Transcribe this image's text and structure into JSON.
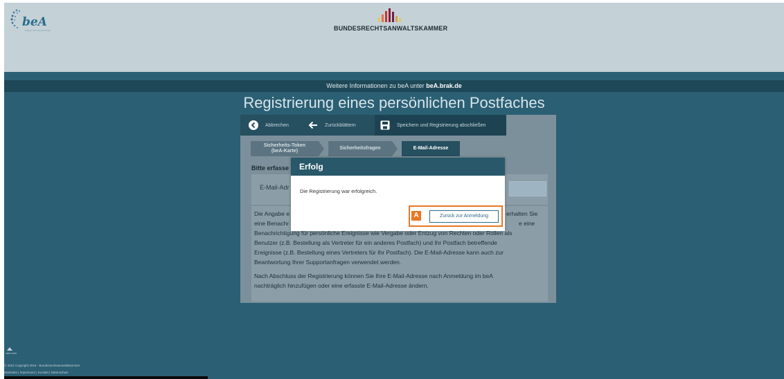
{
  "header": {
    "logo_text": "beA",
    "logo_tagline": "Digitale Schnittstelle Anwalt",
    "brak_name": "BUNDESRECHTSANWALTSKAMMER",
    "brand_colors": [
      "#e9c46a",
      "#e76f51",
      "#c0392b",
      "#8e1b3a",
      "#6b1f4a",
      "#d1a84b"
    ]
  },
  "infobar": {
    "prefix": "Weitere Informationen zu beA unter",
    "link": "beA.brak.de"
  },
  "page_title": "Registrierung eines persönlichen Postfaches",
  "toolbar": {
    "cancel": {
      "icon": "arrow-left-circle-icon",
      "label": "Abbrechen"
    },
    "back": {
      "icon": "arrow-left-icon",
      "label": "Zurückblättern"
    },
    "save": {
      "icon": "save-icon",
      "label": "Speichern und Registrierung abschließen"
    }
  },
  "steps": [
    {
      "label_line1": "Sicherheits-Token",
      "label_line2": "(beA-Karte)",
      "active": false
    },
    {
      "label_line1": "Sicherheitsfragen",
      "label_line2": "",
      "active": false
    },
    {
      "label_line1": "E-Mail-Adresse",
      "label_line2": "",
      "active": true
    }
  ],
  "form": {
    "heading": "Bitte erfasse",
    "email_label": "E-Mail-Adr",
    "email_value": ""
  },
  "text": {
    "p1_l1": "Die Angabe e",
    "p1_l1_right": "erhalten Sie",
    "p1_l2": "eine Benachr",
    "p1_l2_right": "e eine",
    "p1_l3": "Benachrichtigung für persönliche Ereignisse wie Vergabe oder Entzug von Rechten oder Rollen als",
    "p1_l4": "Benutzer (z.B. Bestellung als Vertreter für ein anderes Postfach) und Ihr Postfach betreffende",
    "p1_l5": "Ereignisse (z.B. Bestellung eines Vertreters für Ihr Postfach). Die E-Mail-Adresse kann auch zur",
    "p1_l6": "Beantwortung Ihrer Supportanfragen verwendet werden.",
    "p2_l1": "Nach Abschluss der Registrierung können Sie Ihre E-Mail-Adresse nach Anmeldung im beA",
    "p2_l2": "nachträglich hinzufügen oder eine erfasste E-Mail-Adresse ändern."
  },
  "dialog": {
    "title": "Erfolg",
    "message": "Die Registrierung war erfolgreich.",
    "badge": "A",
    "button": "Zurück zur Anmeldung"
  },
  "footer": {
    "scroll_label": "nach oben",
    "copyright": "© 2022 Copyright 2015 - Bundesrechtsanwaltskammer",
    "links": [
      "Startseite",
      "Impressum",
      "Kontakt",
      "Datenschutz"
    ]
  },
  "colors": {
    "accent_orange": "#e87722",
    "header_bg": "#c4d1d7",
    "page_bg": "#2b5f74",
    "dialog_head": "#285869"
  }
}
